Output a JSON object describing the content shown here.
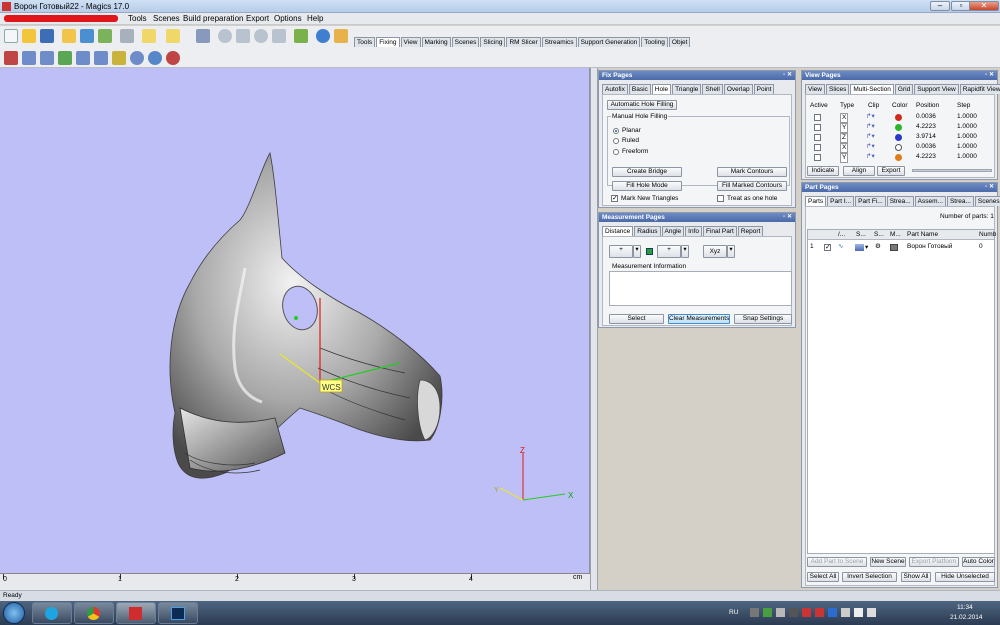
{
  "window": {
    "title": "Ворон Готовый22 - Magics 17.0"
  },
  "menu": [
    "Tools",
    "Scenes",
    "Build preparation",
    "Export",
    "Options",
    "Help"
  ],
  "toolbar_tabs": [
    "Tools",
    "Fixing",
    "View",
    "Marking",
    "Scenes",
    "Slicing",
    "RM Slicer",
    "Streamics",
    "Support Generation",
    "Tooling",
    "Objet"
  ],
  "toolbar_active_tab": "Fixing",
  "viewport": {
    "bg": "#bebff7",
    "wcs_label": "WCS",
    "axes": {
      "z": "Z",
      "x": "X",
      "y": "Y"
    },
    "ruler": {
      "ticks": [
        "0",
        "1",
        "2",
        "3",
        "4"
      ],
      "unit": "cm"
    }
  },
  "fix_pages": {
    "title": "Fix Pages",
    "tabs": [
      "Autofix",
      "Basic",
      "Hole",
      "Triangle",
      "Shell",
      "Overlap",
      "Point"
    ],
    "active_tab": "Hole",
    "auto_button": "Automatic Hole Filling",
    "manual_label": "Manual Hole Filling",
    "options": [
      "Planar",
      "Ruled",
      "Freeform"
    ],
    "selected_option": "Planar",
    "buttons": {
      "create_bridge": "Create Bridge",
      "mark_contours": "Mark Contours",
      "fill_hole_mode": "Fill Hole Mode",
      "fill_marked": "Fill Marked Contours"
    },
    "mark_new": "Mark New Triangles",
    "treat_one": "Treat as one hole"
  },
  "measurement_pages": {
    "title": "Measurement Pages",
    "tabs": [
      "Distance",
      "Radius",
      "Angle",
      "Info",
      "Final Part",
      "Report"
    ],
    "active_tab": "Distance",
    "info_label": "Measurement Information",
    "tool_label": "Xyz",
    "buttons": {
      "select": "Select",
      "clear": "Clear Measurements",
      "snap": "Snap Settings"
    }
  },
  "view_pages": {
    "title": "View Pages",
    "tabs": [
      "View",
      "Slices",
      "Multi-Section",
      "Grid",
      "Support View",
      "Rapidfit View"
    ],
    "active_tab": "Multi-Section",
    "columns": [
      "Active",
      "Type",
      "Clip",
      "Color",
      "Position",
      "Step"
    ],
    "rows": [
      {
        "type": "X",
        "color": "#d42a1e",
        "position": "0.0036",
        "step": "1.0000"
      },
      {
        "type": "Y",
        "color": "#2bb52b",
        "position": "4.2223",
        "step": "1.0000"
      },
      {
        "type": "Z",
        "color": "#2a38c8",
        "position": "3.9714",
        "step": "1.0000"
      },
      {
        "type": "X",
        "color": "#ffffff",
        "position": "0.0036",
        "step": "1.0000"
      },
      {
        "type": "Y",
        "color": "#e07b1a",
        "position": "4.2223",
        "step": "1.0000"
      }
    ],
    "buttons": [
      "Indicate",
      "Align",
      "Export"
    ]
  },
  "part_pages": {
    "title": "Part Pages",
    "tabs": [
      "Parts",
      "Part I...",
      "Part Fi...",
      "Strea...",
      "Assem...",
      "Strea...",
      "Scenes"
    ],
    "active_tab": "Parts",
    "num_parts_label": "Number of parts: 1",
    "columns": [
      "/...",
      "S...",
      "S...",
      "M...",
      "Part Name",
      "Numb"
    ],
    "rows": [
      {
        "index": "1",
        "name": "Ворон Готовый",
        "num": "0"
      }
    ],
    "buttons_row1": [
      "Add Part to Scene",
      "New Scene",
      "Export Platform",
      "Auto Color"
    ],
    "buttons_row2": [
      "Select All",
      "Invert Selection",
      "Show All",
      "Hide Unselected"
    ]
  },
  "status": {
    "text": "Ready"
  },
  "taskbar": {
    "lang": "RU",
    "time": "11:34",
    "date": "21.02.2014"
  }
}
